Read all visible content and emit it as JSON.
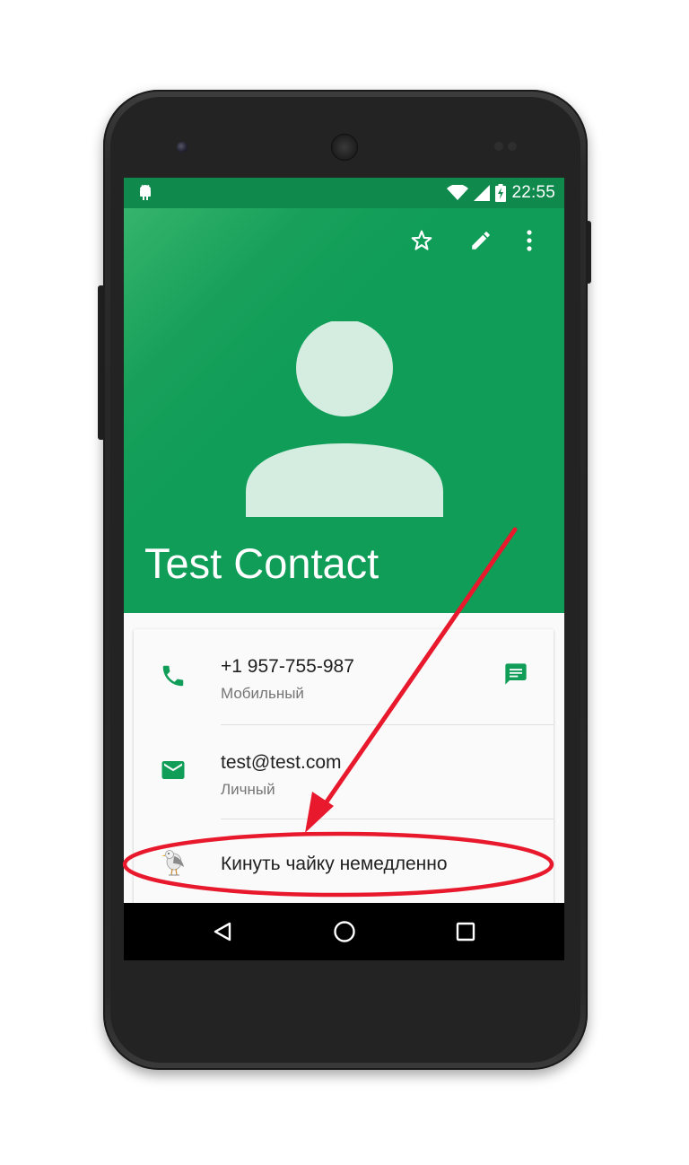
{
  "status_bar": {
    "time": "22:55",
    "icons": [
      "android-debug-icon",
      "wifi-icon",
      "signal-icon",
      "battery-charging-icon"
    ]
  },
  "toolbar": {
    "actions": [
      {
        "name": "favorite",
        "icon": "star-outline-icon"
      },
      {
        "name": "edit",
        "icon": "pencil-icon"
      },
      {
        "name": "more",
        "icon": "more-vert-icon"
      }
    ]
  },
  "contact": {
    "name": "Test Contact",
    "avatar_icon": "person-placeholder-icon"
  },
  "details": {
    "phone": {
      "value": "+1 957-755-987",
      "type": "Мобильный",
      "icon": "phone-icon",
      "action_icon": "message-icon"
    },
    "email": {
      "value": "test@test.com",
      "type": "Личный",
      "icon": "email-icon"
    },
    "custom_action": {
      "label": "Кинуть чайку немедленно",
      "icon": "seagull-icon"
    }
  },
  "navigation": {
    "buttons": [
      {
        "name": "back",
        "icon": "back-triangle-icon"
      },
      {
        "name": "home",
        "icon": "home-circle-icon"
      },
      {
        "name": "recents",
        "icon": "recents-square-icon"
      }
    ]
  },
  "colors": {
    "primary": "#0f9d58",
    "status_bar": "#0f8a4c",
    "annotation": "#e8192c"
  }
}
